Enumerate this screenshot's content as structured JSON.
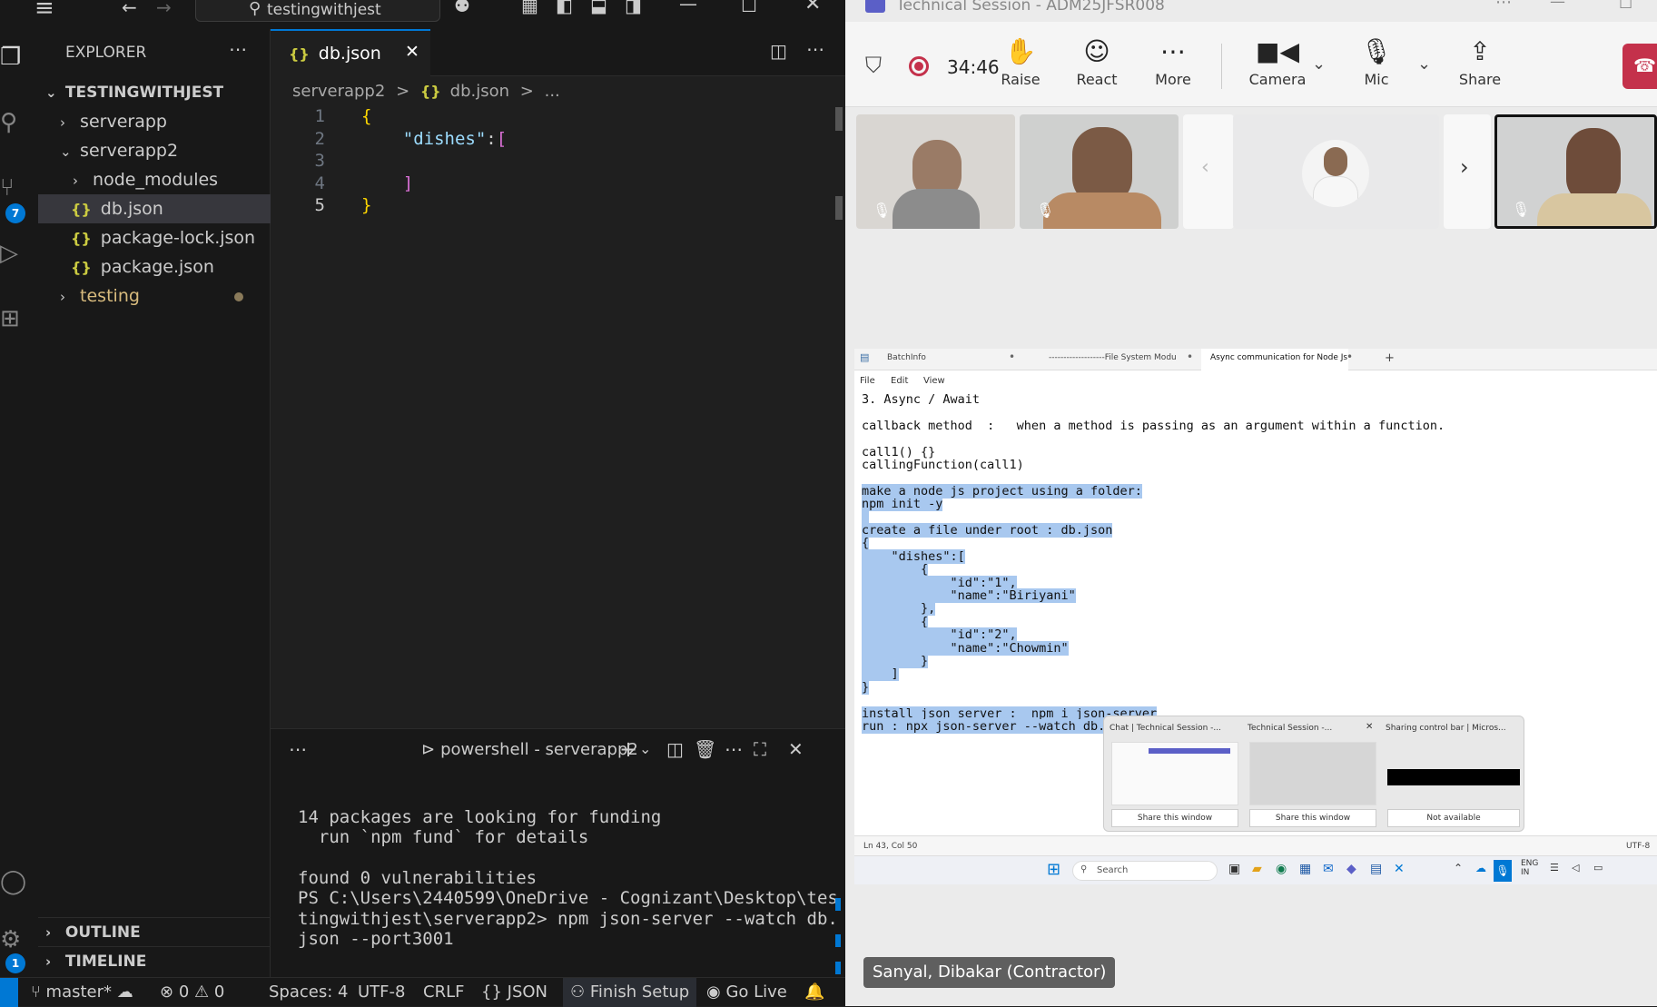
{
  "vscode": {
    "search": "testingwithjest",
    "explorer_title": "EXPLORER",
    "workspace": "TESTINGWITHJEST",
    "tree": [
      {
        "label": "serverapp",
        "type": "folder",
        "open": false
      },
      {
        "label": "serverapp2",
        "type": "folder",
        "open": true
      },
      {
        "label": "node_modules",
        "type": "folder",
        "open": false
      },
      {
        "label": "db.json",
        "type": "json"
      },
      {
        "label": "package-lock.json",
        "type": "json"
      },
      {
        "label": "package.json",
        "type": "json"
      },
      {
        "label": "testing",
        "type": "folder",
        "open": false
      }
    ],
    "outline": "OUTLINE",
    "timeline": "TIMELINE",
    "source_control_badge": "7",
    "settings_badge": "1",
    "tab_label": "db.json",
    "breadcrumb": [
      "serverapp2",
      ">",
      "db.json",
      ">",
      "..."
    ],
    "code": [
      {
        "num": "1",
        "text": "{"
      },
      {
        "num": "2",
        "text": "    \"dishes\":["
      },
      {
        "num": "3",
        "text": ""
      },
      {
        "num": "4",
        "text": "    ]"
      },
      {
        "num": "5",
        "text": "}"
      }
    ],
    "terminal_title": "powershell - serverapp2",
    "terminal_lines": [
      "14 packages are looking for funding",
      "  run `npm fund` for details",
      "",
      "found 0 vulnerabilities",
      "PS C:\\Users\\2440599\\OneDrive - Cognizant\\Desktop\\tes",
      "tingwithjest\\serverapp2> npm json-server --watch db.",
      "json --port3001"
    ],
    "status": {
      "branch": "master*",
      "errors": "0",
      "warnings": "0",
      "spaces": "Spaces: 4",
      "encoding": "UTF-8",
      "eol": "CRLF",
      "language": "JSON",
      "finish_setup": "Finish Setup",
      "go_live": "Go Live"
    }
  },
  "teams": {
    "window_title": "Technical Session - ADM25JFSR008",
    "timer": "34:46",
    "buttons": [
      {
        "label": "Raise",
        "icon": "hand-icon"
      },
      {
        "label": "React",
        "icon": "smiley-icon"
      },
      {
        "label": "More",
        "icon": "more-icon"
      },
      {
        "label": "Camera",
        "icon": "camera-icon"
      },
      {
        "label": "Mic",
        "icon": "mic-off-icon"
      },
      {
        "label": "Share",
        "icon": "share-icon"
      }
    ],
    "presenter": "Sanyal, Dibakar (Contractor)",
    "notepad": {
      "tabs": [
        "BatchInfo",
        "-------------------File System Modu",
        "Async communication for Node Js"
      ],
      "menu": [
        "File",
        "Edit",
        "View"
      ],
      "lines": [
        {
          "text": "3. Async / Await",
          "hl": false
        },
        {
          "text": "",
          "hl": false
        },
        {
          "text": "callback method  :   when a method is passing as an argument within a function.",
          "hl": false
        },
        {
          "text": "",
          "hl": false
        },
        {
          "text": "call1() {}",
          "hl": false
        },
        {
          "text": "callingFunction(call1)",
          "hl": false
        },
        {
          "text": "",
          "hl": false
        },
        {
          "text": "make a node js project using a folder:",
          "hl": true
        },
        {
          "text": "npm init -y",
          "hl": true
        },
        {
          "text": "",
          "hl": true
        },
        {
          "text": "create a file under root : db.json",
          "hl": true
        },
        {
          "text": "{",
          "hl": true
        },
        {
          "text": "    \"dishes\":[",
          "hl": true
        },
        {
          "text": "        {",
          "hl": true
        },
        {
          "text": "            \"id\":\"1\",",
          "hl": true
        },
        {
          "text": "            \"name\":\"Biriyani\"",
          "hl": true
        },
        {
          "text": "        },",
          "hl": true
        },
        {
          "text": "        {",
          "hl": true
        },
        {
          "text": "            \"id\":\"2\",",
          "hl": true
        },
        {
          "text": "            \"name\":\"Chowmin\"",
          "hl": true
        },
        {
          "text": "        }",
          "hl": true
        },
        {
          "text": "    ]",
          "hl": true
        },
        {
          "text": "}",
          "hl": true
        },
        {
          "text": "",
          "hl": false
        },
        {
          "text": "install json server :  npm i json-server",
          "hl": true
        },
        {
          "text": "run : npx json-server --watch db.json --por",
          "hl": true
        }
      ],
      "status": "Ln 43, Col 50",
      "encoding": "UTF-8"
    },
    "taskbar_previews": [
      {
        "title": "Chat | Technical Session -...",
        "action": "Share this window"
      },
      {
        "title": "Technical Session -...",
        "action": "Share this window"
      },
      {
        "title": "Sharing control bar | Micros...",
        "action": "Not available"
      }
    ],
    "taskbar_search": "Search",
    "taskbar_lang": "ENG",
    "taskbar_region": "IN"
  }
}
